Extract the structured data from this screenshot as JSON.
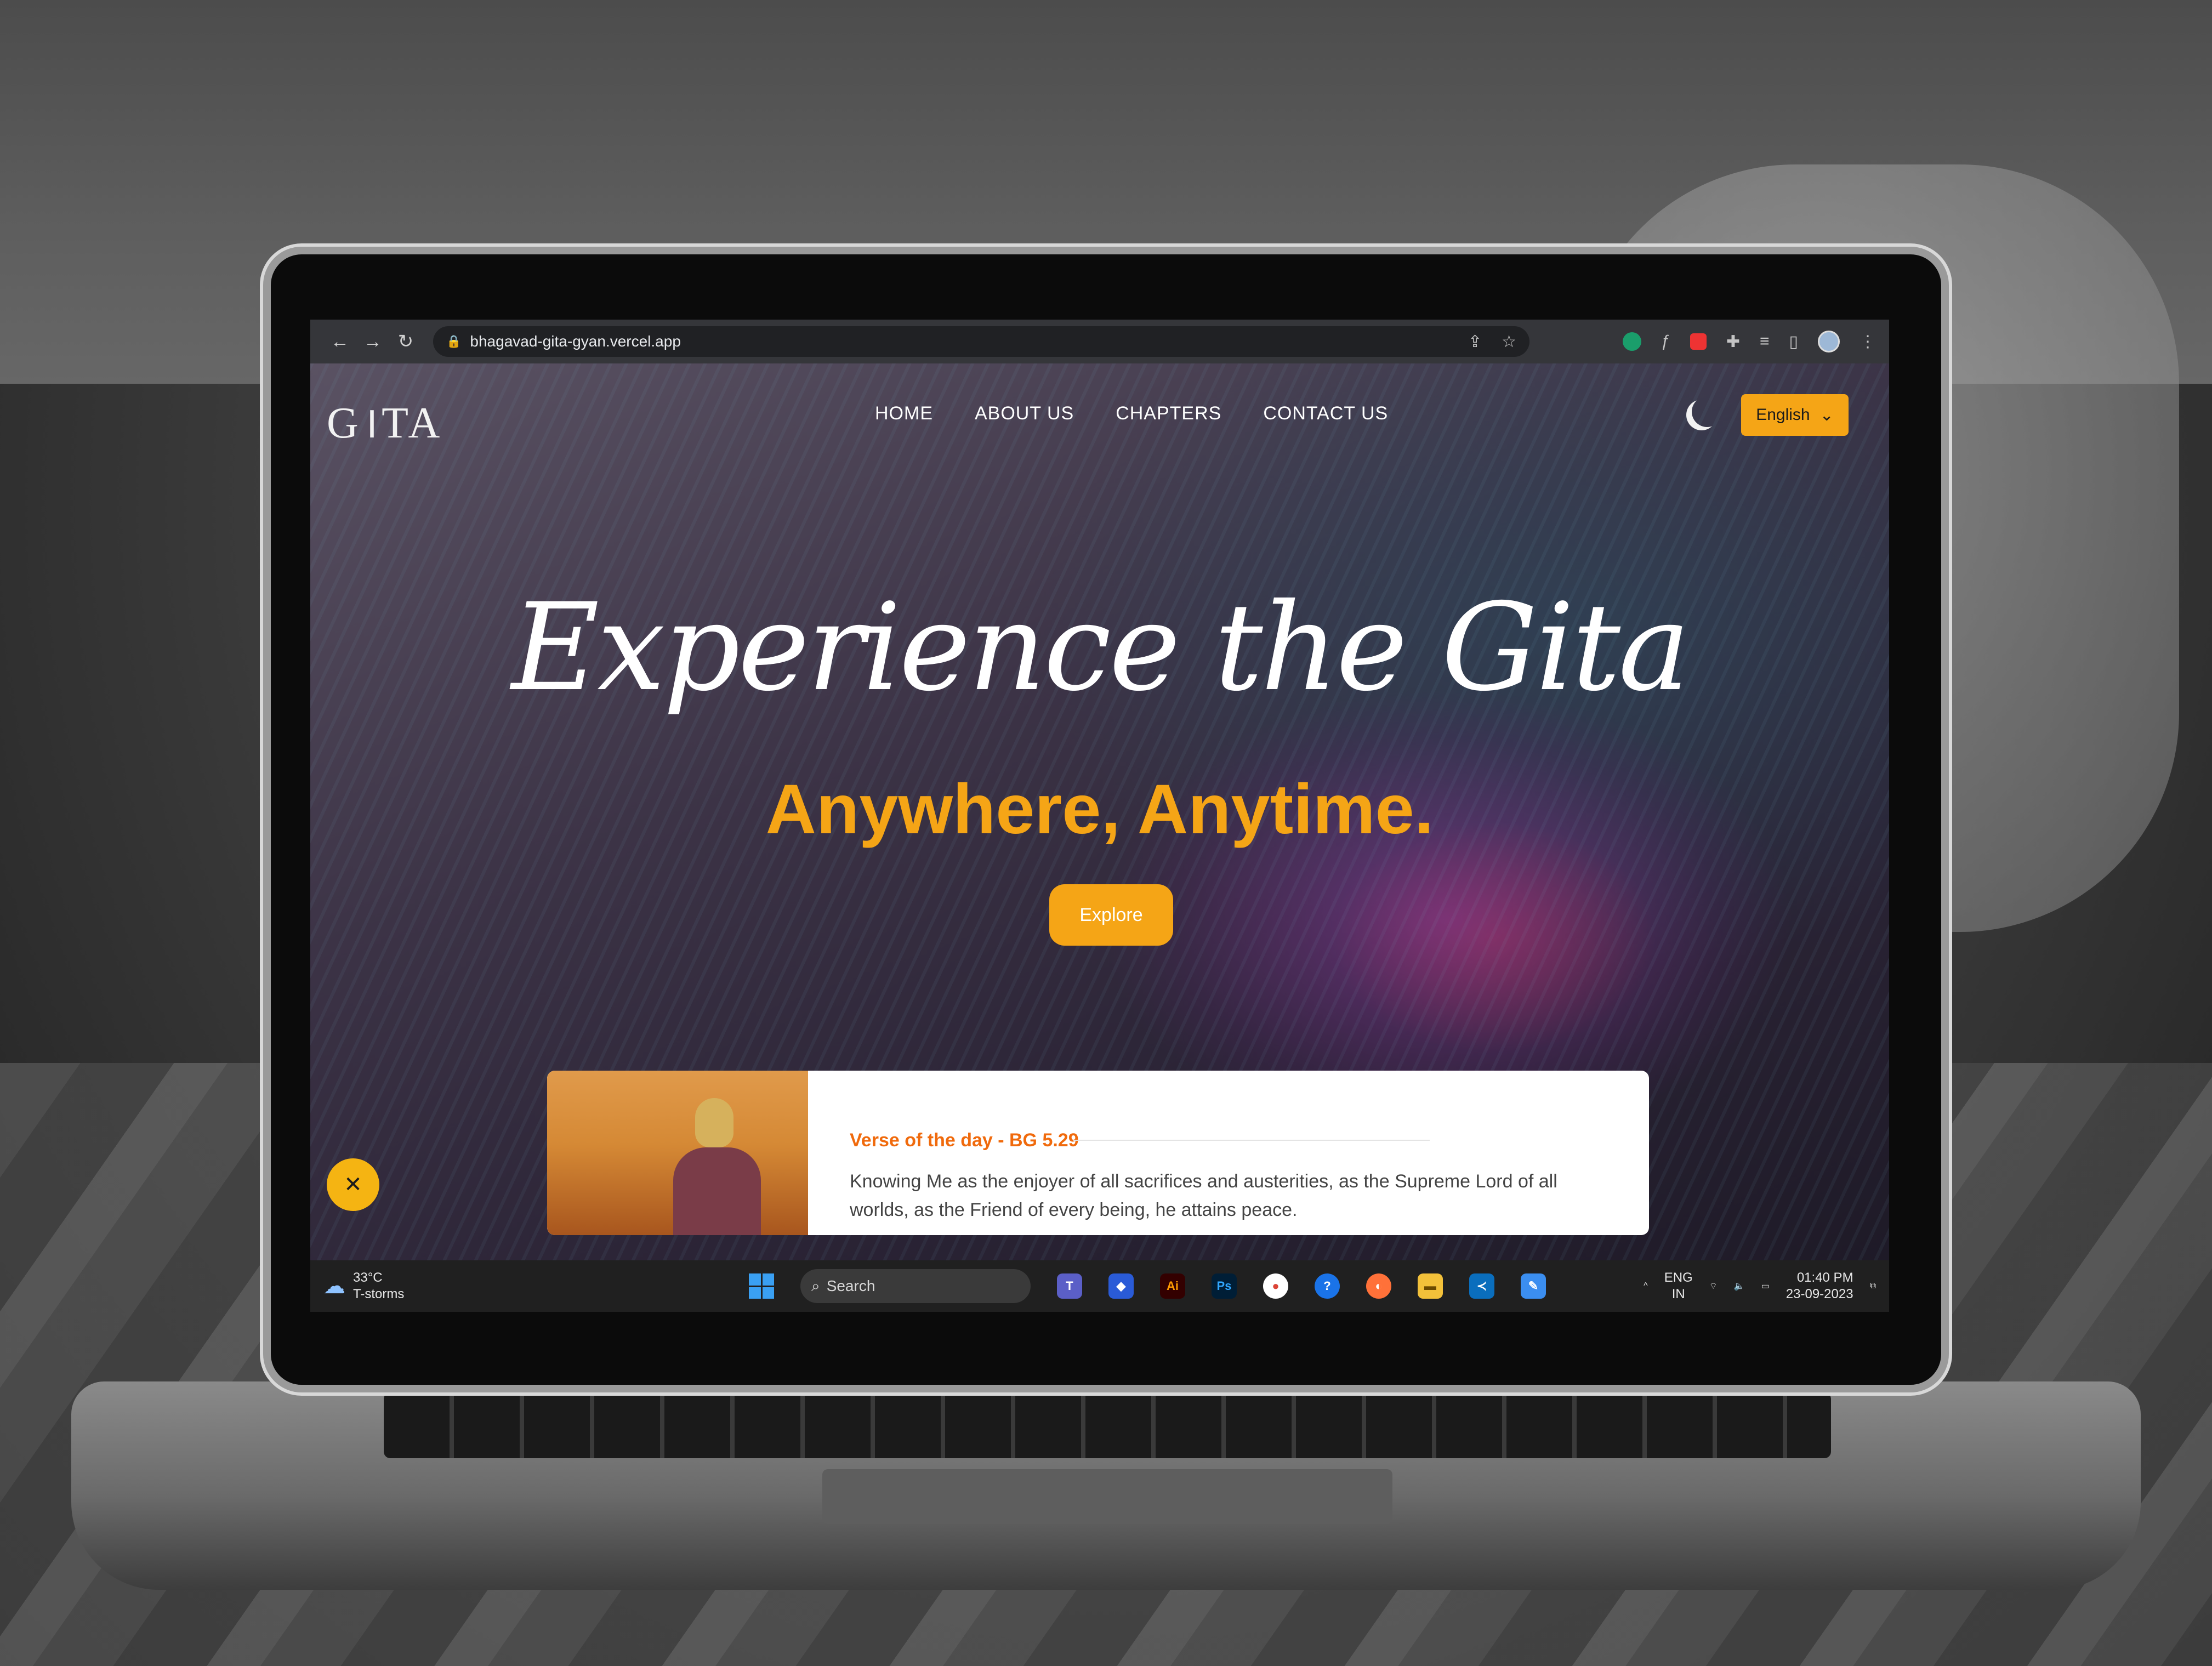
{
  "browser": {
    "url": "bhagavad-gita-gyan.vercel.app"
  },
  "site": {
    "logo": "G।TA",
    "nav": [
      "HOME",
      "ABOUT US",
      "CHAPTERS",
      "CONTACT US"
    ],
    "language": "English",
    "hero_script": "Experience the Gita",
    "hero_sub": "Anywhere, Anytime.",
    "explore_label": "Explore",
    "verse": {
      "title": "Verse of the day - BG 5.29",
      "text": "Knowing Me as the enjoyer of all sacrifices and austerities, as the Supreme Lord of all worlds, as the Friend of every being, he attains peace."
    }
  },
  "taskbar": {
    "weather_temp": "33°C",
    "weather_desc": "T-storms",
    "search_label": "Search",
    "lang_top": "ENG",
    "lang_bottom": "IN",
    "time": "01:40 PM",
    "date": "23-09-2023",
    "apps": [
      "Ai",
      "Ps"
    ]
  },
  "colors": {
    "accent": "#f5a516",
    "verse_title": "#f06a0c"
  }
}
